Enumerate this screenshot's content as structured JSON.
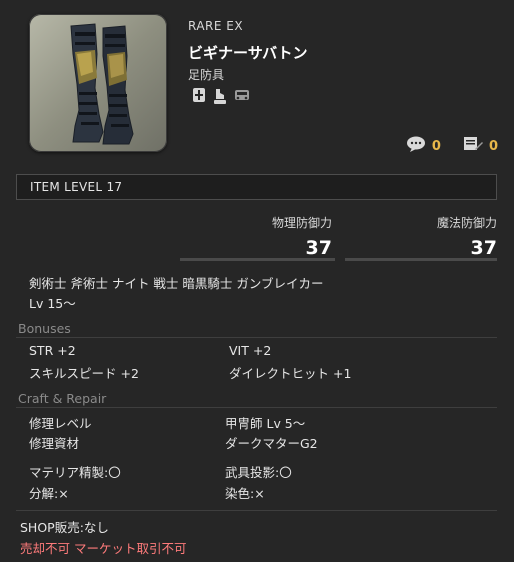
{
  "item": {
    "rarity": "RARE EX",
    "name": "ビギナーサバトン",
    "category": "足防具",
    "flag_icons": [
      "armory-chest-icon",
      "glamour-dresser-icon",
      "retainer-icon"
    ]
  },
  "counters": {
    "comments": "0",
    "bookmarks": "0",
    "comment_icon": "speech-bubble-icon",
    "bookmark_icon": "pencil-note-icon"
  },
  "item_level": "ITEM LEVEL 17",
  "stats": {
    "physical_label": "物理防御力",
    "physical_value": "37",
    "magic_label": "魔法防御力",
    "magic_value": "37"
  },
  "jobs": "剣術士 斧術士 ナイト 戦士 暗黒騎士 ガンブレイカー",
  "level_req": "Lv 15〜",
  "bonuses": {
    "heading": "Bonuses",
    "items": [
      {
        "name": "STR",
        "value": "+2"
      },
      {
        "name": "VIT",
        "value": "+2"
      },
      {
        "name": "スキルスピード",
        "value": "+2"
      },
      {
        "name": "ダイレクトヒット",
        "value": "+1"
      }
    ]
  },
  "craft": {
    "heading": "Craft & Repair",
    "repair_level_label": "修理レベル",
    "repair_level_value": "甲冑師 Lv 5〜",
    "repair_material_label": "修理資材",
    "repair_material_value": "ダークマターG2",
    "materia": "マテリア精製:〇",
    "glamour": "武具投影:〇",
    "desynth": "分解:×",
    "dye": "染色:×"
  },
  "shop": {
    "sale": "SHOP販売:なし",
    "restrictions": "売却不可 マーケット取引不可"
  },
  "colors": {
    "background": "#262626",
    "accent_gold": "#e8b84a",
    "warning": "#ff7b7b",
    "muted": "#8a8a8a"
  }
}
